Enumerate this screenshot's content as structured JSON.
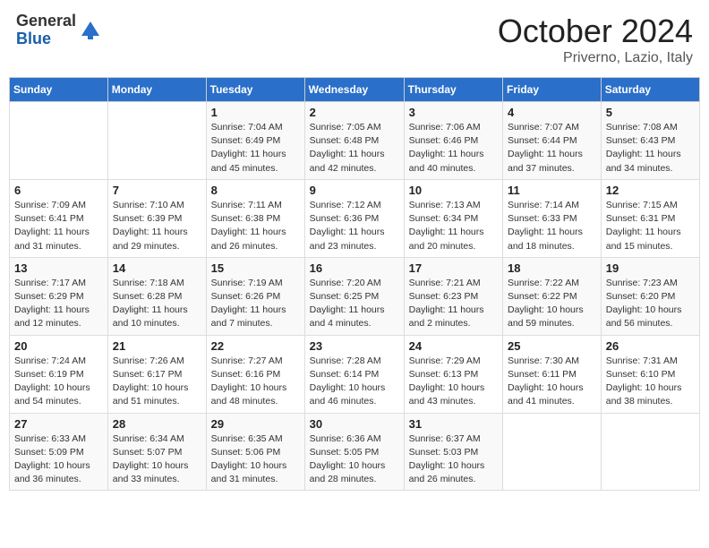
{
  "header": {
    "logo_general": "General",
    "logo_blue": "Blue",
    "month": "October 2024",
    "location": "Priverno, Lazio, Italy"
  },
  "weekdays": [
    "Sunday",
    "Monday",
    "Tuesday",
    "Wednesday",
    "Thursday",
    "Friday",
    "Saturday"
  ],
  "weeks": [
    [
      {
        "day": "",
        "sunrise": "",
        "sunset": "",
        "daylight": ""
      },
      {
        "day": "",
        "sunrise": "",
        "sunset": "",
        "daylight": ""
      },
      {
        "day": "1",
        "sunrise": "Sunrise: 7:04 AM",
        "sunset": "Sunset: 6:49 PM",
        "daylight": "Daylight: 11 hours and 45 minutes."
      },
      {
        "day": "2",
        "sunrise": "Sunrise: 7:05 AM",
        "sunset": "Sunset: 6:48 PM",
        "daylight": "Daylight: 11 hours and 42 minutes."
      },
      {
        "day": "3",
        "sunrise": "Sunrise: 7:06 AM",
        "sunset": "Sunset: 6:46 PM",
        "daylight": "Daylight: 11 hours and 40 minutes."
      },
      {
        "day": "4",
        "sunrise": "Sunrise: 7:07 AM",
        "sunset": "Sunset: 6:44 PM",
        "daylight": "Daylight: 11 hours and 37 minutes."
      },
      {
        "day": "5",
        "sunrise": "Sunrise: 7:08 AM",
        "sunset": "Sunset: 6:43 PM",
        "daylight": "Daylight: 11 hours and 34 minutes."
      }
    ],
    [
      {
        "day": "6",
        "sunrise": "Sunrise: 7:09 AM",
        "sunset": "Sunset: 6:41 PM",
        "daylight": "Daylight: 11 hours and 31 minutes."
      },
      {
        "day": "7",
        "sunrise": "Sunrise: 7:10 AM",
        "sunset": "Sunset: 6:39 PM",
        "daylight": "Daylight: 11 hours and 29 minutes."
      },
      {
        "day": "8",
        "sunrise": "Sunrise: 7:11 AM",
        "sunset": "Sunset: 6:38 PM",
        "daylight": "Daylight: 11 hours and 26 minutes."
      },
      {
        "day": "9",
        "sunrise": "Sunrise: 7:12 AM",
        "sunset": "Sunset: 6:36 PM",
        "daylight": "Daylight: 11 hours and 23 minutes."
      },
      {
        "day": "10",
        "sunrise": "Sunrise: 7:13 AM",
        "sunset": "Sunset: 6:34 PM",
        "daylight": "Daylight: 11 hours and 20 minutes."
      },
      {
        "day": "11",
        "sunrise": "Sunrise: 7:14 AM",
        "sunset": "Sunset: 6:33 PM",
        "daylight": "Daylight: 11 hours and 18 minutes."
      },
      {
        "day": "12",
        "sunrise": "Sunrise: 7:15 AM",
        "sunset": "Sunset: 6:31 PM",
        "daylight": "Daylight: 11 hours and 15 minutes."
      }
    ],
    [
      {
        "day": "13",
        "sunrise": "Sunrise: 7:17 AM",
        "sunset": "Sunset: 6:29 PM",
        "daylight": "Daylight: 11 hours and 12 minutes."
      },
      {
        "day": "14",
        "sunrise": "Sunrise: 7:18 AM",
        "sunset": "Sunset: 6:28 PM",
        "daylight": "Daylight: 11 hours and 10 minutes."
      },
      {
        "day": "15",
        "sunrise": "Sunrise: 7:19 AM",
        "sunset": "Sunset: 6:26 PM",
        "daylight": "Daylight: 11 hours and 7 minutes."
      },
      {
        "day": "16",
        "sunrise": "Sunrise: 7:20 AM",
        "sunset": "Sunset: 6:25 PM",
        "daylight": "Daylight: 11 hours and 4 minutes."
      },
      {
        "day": "17",
        "sunrise": "Sunrise: 7:21 AM",
        "sunset": "Sunset: 6:23 PM",
        "daylight": "Daylight: 11 hours and 2 minutes."
      },
      {
        "day": "18",
        "sunrise": "Sunrise: 7:22 AM",
        "sunset": "Sunset: 6:22 PM",
        "daylight": "Daylight: 10 hours and 59 minutes."
      },
      {
        "day": "19",
        "sunrise": "Sunrise: 7:23 AM",
        "sunset": "Sunset: 6:20 PM",
        "daylight": "Daylight: 10 hours and 56 minutes."
      }
    ],
    [
      {
        "day": "20",
        "sunrise": "Sunrise: 7:24 AM",
        "sunset": "Sunset: 6:19 PM",
        "daylight": "Daylight: 10 hours and 54 minutes."
      },
      {
        "day": "21",
        "sunrise": "Sunrise: 7:26 AM",
        "sunset": "Sunset: 6:17 PM",
        "daylight": "Daylight: 10 hours and 51 minutes."
      },
      {
        "day": "22",
        "sunrise": "Sunrise: 7:27 AM",
        "sunset": "Sunset: 6:16 PM",
        "daylight": "Daylight: 10 hours and 48 minutes."
      },
      {
        "day": "23",
        "sunrise": "Sunrise: 7:28 AM",
        "sunset": "Sunset: 6:14 PM",
        "daylight": "Daylight: 10 hours and 46 minutes."
      },
      {
        "day": "24",
        "sunrise": "Sunrise: 7:29 AM",
        "sunset": "Sunset: 6:13 PM",
        "daylight": "Daylight: 10 hours and 43 minutes."
      },
      {
        "day": "25",
        "sunrise": "Sunrise: 7:30 AM",
        "sunset": "Sunset: 6:11 PM",
        "daylight": "Daylight: 10 hours and 41 minutes."
      },
      {
        "day": "26",
        "sunrise": "Sunrise: 7:31 AM",
        "sunset": "Sunset: 6:10 PM",
        "daylight": "Daylight: 10 hours and 38 minutes."
      }
    ],
    [
      {
        "day": "27",
        "sunrise": "Sunrise: 6:33 AM",
        "sunset": "Sunset: 5:09 PM",
        "daylight": "Daylight: 10 hours and 36 minutes."
      },
      {
        "day": "28",
        "sunrise": "Sunrise: 6:34 AM",
        "sunset": "Sunset: 5:07 PM",
        "daylight": "Daylight: 10 hours and 33 minutes."
      },
      {
        "day": "29",
        "sunrise": "Sunrise: 6:35 AM",
        "sunset": "Sunset: 5:06 PM",
        "daylight": "Daylight: 10 hours and 31 minutes."
      },
      {
        "day": "30",
        "sunrise": "Sunrise: 6:36 AM",
        "sunset": "Sunset: 5:05 PM",
        "daylight": "Daylight: 10 hours and 28 minutes."
      },
      {
        "day": "31",
        "sunrise": "Sunrise: 6:37 AM",
        "sunset": "Sunset: 5:03 PM",
        "daylight": "Daylight: 10 hours and 26 minutes."
      },
      {
        "day": "",
        "sunrise": "",
        "sunset": "",
        "daylight": ""
      },
      {
        "day": "",
        "sunrise": "",
        "sunset": "",
        "daylight": ""
      }
    ]
  ]
}
